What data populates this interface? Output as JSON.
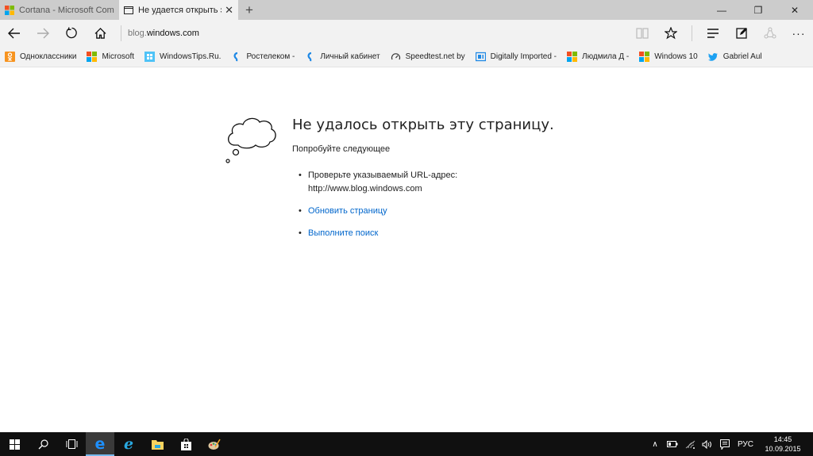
{
  "browser": {
    "tabs": [
      {
        "label": "Cortana - Microsoft Commu",
        "icon": "microsoft-logo-icon",
        "active": false
      },
      {
        "label": "Не удается открыть эту",
        "icon": "page-icon",
        "active": true,
        "close": "✕"
      }
    ],
    "new_tab": "+",
    "window_controls": {
      "minimize": "—",
      "restore": "❐",
      "close": "✕"
    },
    "address": {
      "dim_part": "blog.",
      "main_part": "windows.com"
    },
    "favorites": [
      {
        "label": "Одноклассники",
        "icon": "odnoklassniki-icon"
      },
      {
        "label": "Microsoft",
        "icon": "microsoft-logo-icon"
      },
      {
        "label": "WindowsTips.Ru.",
        "icon": "windows-icon"
      },
      {
        "label": "Ростелеком -",
        "icon": "rostelecom-icon"
      },
      {
        "label": "Личный кабинет",
        "icon": "rostelecom-icon"
      },
      {
        "label": "Speedtest.net by",
        "icon": "speedometer-icon"
      },
      {
        "label": "Digitally Imported -",
        "icon": "di-icon"
      },
      {
        "label": "Людмила Д -",
        "icon": "microsoft-logo-icon"
      },
      {
        "label": "Windows 10",
        "icon": "microsoft-logo-icon"
      },
      {
        "label": "Gabriel Aul",
        "icon": "twitter-icon"
      }
    ]
  },
  "error_page": {
    "title": "Не удалось открыть эту страницу.",
    "subtitle": "Попробуйте следующее",
    "items": [
      {
        "text": "Проверьте указываемый URL-адрес:",
        "url": "http://www.blog.windows.com"
      },
      {
        "link": "Обновить страницу"
      },
      {
        "link": "Выполните поиск"
      }
    ]
  },
  "taskbar": {
    "tray": {
      "language": "РУС",
      "time": "14:45",
      "date": "10.09.2015"
    }
  },
  "colors": {
    "link": "#0066cc",
    "accent": "#76b9ed"
  }
}
